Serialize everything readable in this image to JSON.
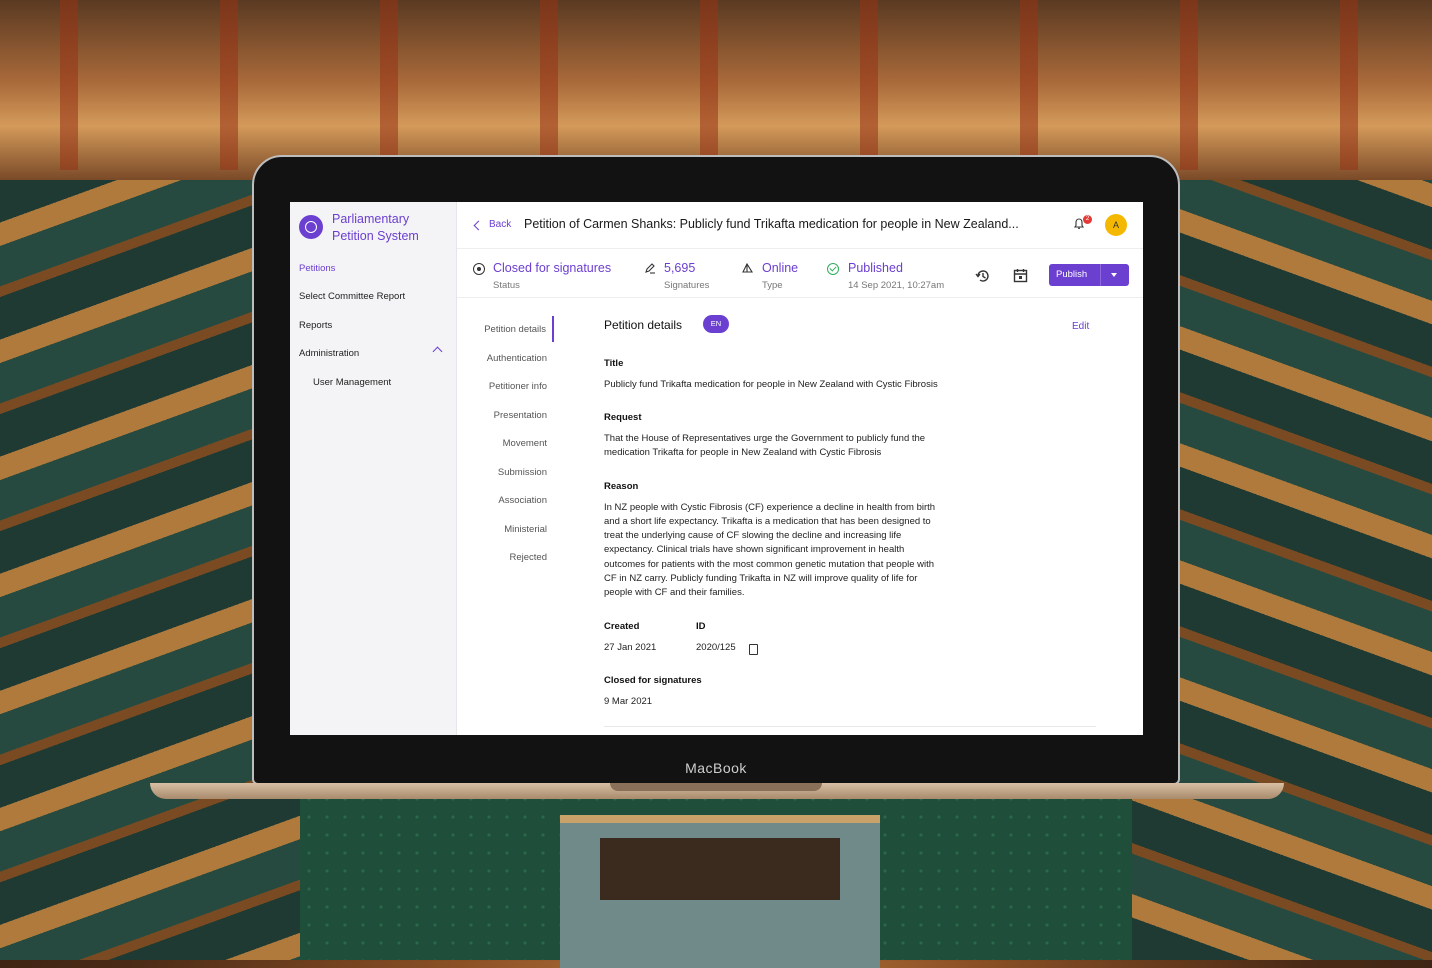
{
  "sidebar": {
    "app_title": "Parliamentary Petition System",
    "items": [
      {
        "label": "Petitions"
      },
      {
        "label": "Select Committee Report"
      },
      {
        "label": "Reports"
      },
      {
        "label": "Administration"
      },
      {
        "label": "User Management"
      }
    ]
  },
  "header": {
    "back_label": "Back",
    "title": "Petition of Carmen Shanks: Publicly fund Trikafta medication for people in New Zealand...",
    "notification_count": "2",
    "avatar_initial": "A"
  },
  "stats": {
    "status": {
      "value": "Closed for signatures",
      "label": "Status"
    },
    "signatures": {
      "value": "5,695",
      "label": "Signatures"
    },
    "type": {
      "value": "Online",
      "label": "Type"
    },
    "published": {
      "value": "Published",
      "label": "14 Sep 2021, 10:27am"
    },
    "publish_button": "Publish"
  },
  "subnav": {
    "items": [
      {
        "label": "Petition details"
      },
      {
        "label": "Authentication"
      },
      {
        "label": "Petitioner info"
      },
      {
        "label": "Presentation"
      },
      {
        "label": "Movement"
      },
      {
        "label": "Submission"
      },
      {
        "label": "Association"
      },
      {
        "label": "Ministerial"
      },
      {
        "label": "Rejected"
      }
    ]
  },
  "details": {
    "section_title": "Petition details",
    "language_badge": "EN",
    "edit_label": "Edit",
    "title_label": "Title",
    "title_value": "Publicly fund Trikafta medication for people in New Zealand with Cystic Fibrosis",
    "request_label": "Request",
    "request_line1": "That the House of Representatives urge the Government to publicly fund the",
    "request_line2": "medication Trikafta for people in New Zealand with Cystic Fibrosis",
    "reason_label": "Reason",
    "reason_lines": [
      "In NZ people with Cystic Fibrosis (CF) experience a decline in health from birth",
      "and a short life expectancy. Trikafta is a medication that has been designed to",
      "treat the underlying cause of CF slowing the decline and increasing life",
      "expectancy. Clinical trials have shown significant improvement in health",
      "outcomes for patients with the most common genetic mutation that people with",
      "CF in NZ carry. Publicly funding Trikafta in NZ will improve quality of life for",
      "people with CF and their families."
    ],
    "created_label": "Created",
    "created_value": "27 Jan 2021",
    "id_label": "ID",
    "id_value": "2020/125",
    "closed_label": "Closed for signatures",
    "closed_value": "9 Mar 2021"
  },
  "device": {
    "label": "MacBook"
  }
}
